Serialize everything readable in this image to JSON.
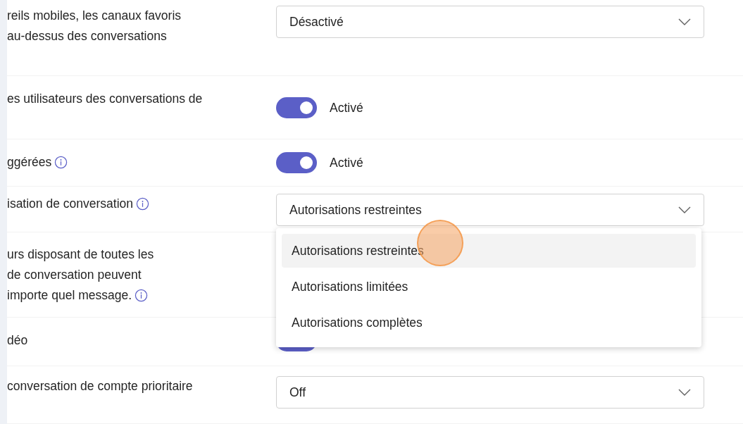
{
  "rows": [
    {
      "label_lines": [
        "reils mobiles, les canaux favoris",
        "au-dessus des conversations"
      ],
      "control": {
        "kind": "select",
        "value": "Désactivé"
      }
    },
    {
      "label_lines": [
        "es utilisateurs des conversations de"
      ],
      "control": {
        "kind": "toggle",
        "on": true,
        "label": "Activé"
      }
    },
    {
      "label_lines": [
        "ggérées"
      ],
      "info": true,
      "control": {
        "kind": "toggle",
        "on": true,
        "label": "Activé"
      }
    },
    {
      "label_lines": [
        "isation de conversation"
      ],
      "info": true,
      "control": {
        "kind": "select",
        "value": "Autorisations restreintes",
        "options": [
          {
            "label": "Autorisations restreintes",
            "selected": true
          },
          {
            "label": "Autorisations limitées",
            "selected": false
          },
          {
            "label": "Autorisations complètes",
            "selected": false
          }
        ]
      }
    },
    {
      "label_lines": [
        "urs disposant de toutes les",
        "de conversation peuvent",
        "importe quel message."
      ],
      "info": true
    },
    {
      "label_lines": [
        "déo"
      ],
      "control": {
        "kind": "toggle",
        "on": true
      }
    },
    {
      "label_lines": [
        "conversation de compte prioritaire"
      ],
      "control": {
        "kind": "select",
        "value": "Off"
      }
    }
  ]
}
